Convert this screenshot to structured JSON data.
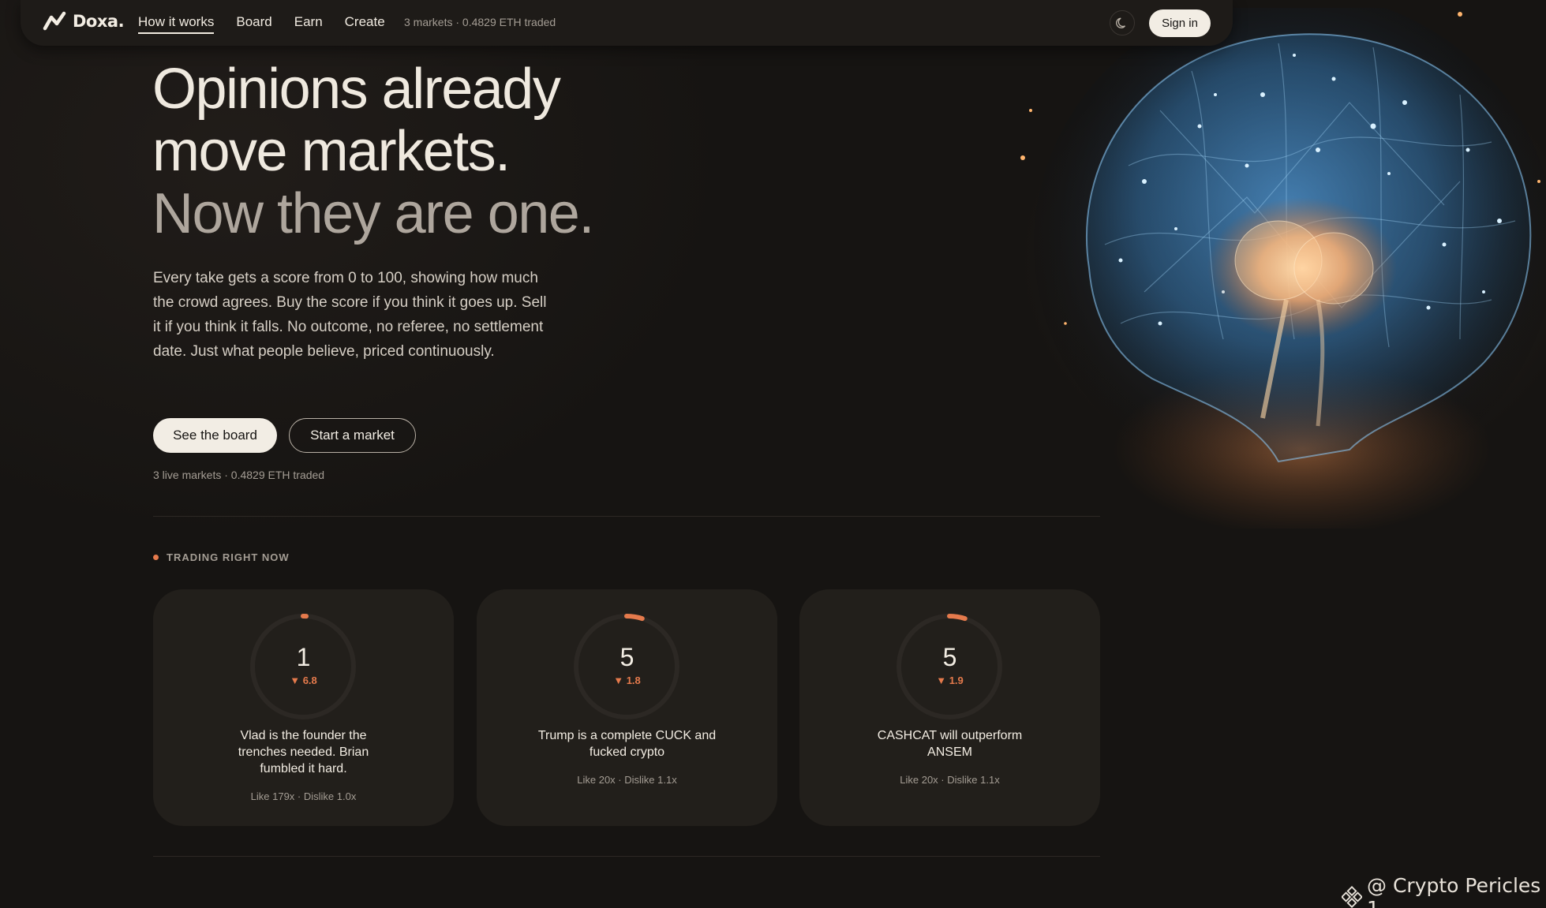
{
  "brand": {
    "name": "Doxa."
  },
  "nav": {
    "links": [
      {
        "label": "How it works",
        "active": true
      },
      {
        "label": "Board",
        "active": false
      },
      {
        "label": "Earn",
        "active": false
      },
      {
        "label": "Create",
        "active": false
      }
    ],
    "stats": "3 markets · 0.4829 ETH traded",
    "signin_label": "Sign in"
  },
  "hero": {
    "title_line1": "Opinions already",
    "title_line2": "move markets.",
    "title_line3": "Now they are one.",
    "description": "Every take gets a score from 0 to 100, showing how much the crowd agrees. Buy the score if you think it goes up. Sell it if you think it falls. No outcome, no referee, no settlement date. Just what people believe, priced continuously.",
    "primary_button": "See the board",
    "secondary_button": "Start a market",
    "stats": "3 live markets · 0.4829 ETH traded"
  },
  "trading": {
    "section_label": "TRADING RIGHT NOW",
    "cards": [
      {
        "score": "1",
        "score_value": 1,
        "change": "▼ 6.8",
        "title": "Vlad is the founder the trenches needed. Brian fumbled it hard.",
        "meta": "Like 179x · Dislike 1.0x"
      },
      {
        "score": "5",
        "score_value": 5,
        "change": "▼ 1.8",
        "title": "Trump is a complete CUCK and fucked crypto",
        "meta": "Like 20x · Dislike 1.1x"
      },
      {
        "score": "5",
        "score_value": 5,
        "change": "▼ 1.9",
        "title": "CASHCAT will outperform ANSEM",
        "meta": "Like 20x · Dislike 1.1x"
      }
    ]
  },
  "watermark": {
    "text": "@ Crypto Pericles 1"
  },
  "colors": {
    "accent": "#e57a4c",
    "background": "#161412",
    "card": "#221f1b",
    "text": "#efe9df"
  },
  "icons": {
    "logo": "zigzag-chart-icon",
    "theme": "moon-icon",
    "watermark": "binance-diamond-icon"
  }
}
